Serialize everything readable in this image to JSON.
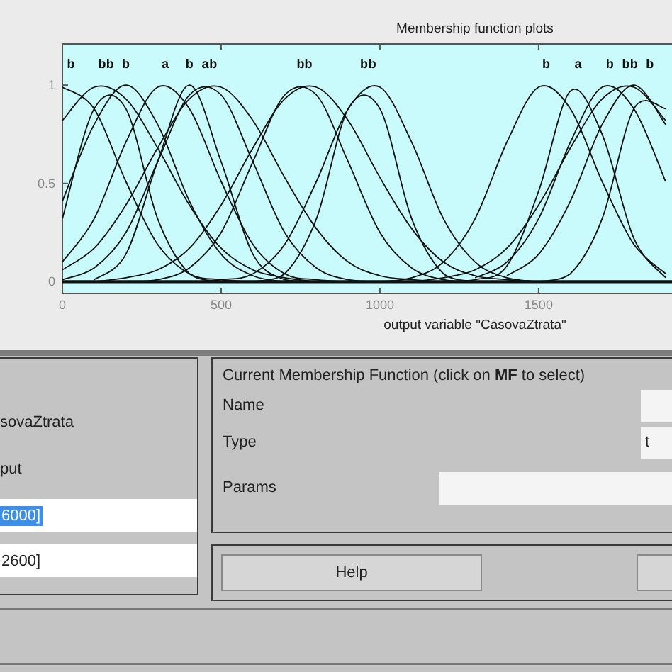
{
  "chart": {
    "chart_data": {
      "type": "line",
      "title": "Membership function plots",
      "xlabel": "output variable \"CasovaZtrata\"",
      "x": [
        0,
        100,
        200,
        300,
        400,
        500,
        600,
        700,
        800,
        900,
        1000,
        1100,
        1200,
        1300,
        1400,
        1500,
        1600,
        1700,
        1800,
        1900
      ],
      "xlim": [
        0,
        1920
      ],
      "ylim": [
        -0.06,
        1.21
      ],
      "xticks": [
        0,
        500,
        1000,
        1500
      ],
      "yticks": [
        0,
        0.5,
        1
      ],
      "series": [
        {
          "values": [
            0.99,
            0.88,
            0.51,
            0.19,
            0.04,
            0.01,
            0,
            null,
            null,
            null,
            null,
            null,
            null,
            null,
            null,
            null,
            null,
            null,
            null,
            null
          ]
        },
        {
          "values": [
            0.82,
            0.99,
            0.93,
            0.68,
            0.39,
            0.17,
            0.06,
            0.02,
            0,
            null,
            null,
            null,
            null,
            null,
            null,
            null,
            null,
            null,
            null,
            null
          ]
        },
        {
          "values": [
            0.32,
            0.88,
            0.88,
            0.32,
            0.04,
            0,
            null,
            null,
            null,
            null,
            null,
            null,
            null,
            null,
            null,
            null,
            null,
            null,
            null,
            null
          ]
        },
        {
          "values": [
            0.41,
            0.8,
            1,
            0.8,
            0.41,
            0.14,
            0.03,
            0,
            null,
            null,
            null,
            null,
            null,
            null,
            null,
            null,
            null,
            null,
            null,
            null
          ]
        },
        {
          "values": [
            0.1,
            0.32,
            0.71,
            0.99,
            0.88,
            0.51,
            0.19,
            0.04,
            0.01,
            0,
            null,
            null,
            null,
            null,
            null,
            null,
            null,
            null,
            null,
            null
          ]
        },
        {
          "values": [
            null,
            0.01,
            0.14,
            0.61,
            1,
            0.61,
            0.14,
            0.01,
            0,
            null,
            null,
            null,
            null,
            null,
            null,
            null,
            null,
            null,
            null,
            null
          ]
        },
        {
          "values": [
            0.01,
            0.07,
            0.25,
            0.61,
            0.95,
            0.95,
            0.61,
            0.25,
            0.07,
            0.01,
            0,
            null,
            null,
            null,
            null,
            null,
            null,
            null,
            null,
            null
          ]
        },
        {
          "values": [
            0.06,
            0.17,
            0.39,
            0.68,
            0.93,
            0.99,
            0.82,
            0.53,
            0.27,
            0.1,
            0.03,
            0.01,
            0,
            null,
            null,
            null,
            null,
            null,
            null,
            null
          ]
        },
        {
          "values": [
            null,
            null,
            0,
            0.01,
            0.07,
            0.25,
            0.61,
            0.95,
            0.95,
            0.61,
            0.25,
            0.07,
            0.01,
            0,
            null,
            null,
            null,
            null,
            null,
            null
          ]
        },
        {
          "values": [
            null,
            0,
            0.02,
            0.06,
            0.17,
            0.39,
            0.68,
            0.93,
            0.99,
            0.82,
            0.53,
            0.27,
            0.1,
            0.03,
            0.01,
            0,
            null,
            null,
            null,
            null
          ]
        },
        {
          "values": [
            null,
            null,
            null,
            null,
            null,
            null,
            0,
            0.04,
            0.32,
            0.88,
            0.88,
            0.32,
            0.04,
            0,
            null,
            null,
            null,
            null,
            null,
            null
          ]
        },
        {
          "values": [
            null,
            null,
            null,
            null,
            0,
            0.01,
            0.04,
            0.19,
            0.51,
            0.88,
            0.99,
            0.71,
            0.32,
            0.1,
            0.02,
            0,
            null,
            null,
            null,
            null
          ]
        },
        {
          "values": [
            null,
            null,
            null,
            null,
            null,
            null,
            null,
            null,
            null,
            null,
            0,
            0.02,
            0.1,
            0.32,
            0.71,
            0.99,
            0.88,
            0.51,
            0.19,
            0.04
          ]
        },
        {
          "values": [
            null,
            null,
            null,
            null,
            null,
            null,
            null,
            null,
            null,
            null,
            null,
            null,
            0,
            0.01,
            0.08,
            0.46,
            0.97,
            0.75,
            0.22,
            0.02
          ]
        },
        {
          "values": [
            null,
            null,
            null,
            null,
            null,
            null,
            null,
            null,
            null,
            null,
            null,
            null,
            null,
            0.02,
            0.1,
            0.32,
            0.71,
            0.99,
            0.88,
            0.51
          ]
        },
        {
          "values": [
            null,
            null,
            null,
            null,
            null,
            null,
            null,
            null,
            null,
            null,
            null,
            0,
            0.02,
            0.06,
            0.17,
            0.39,
            0.68,
            0.93,
            0.99,
            0.82
          ]
        },
        {
          "values": [
            null,
            null,
            null,
            null,
            null,
            null,
            null,
            null,
            null,
            null,
            null,
            null,
            null,
            null,
            0.03,
            0.14,
            0.41,
            0.8,
            1,
            0.8
          ]
        },
        {
          "values": [
            null,
            null,
            null,
            null,
            null,
            null,
            null,
            null,
            null,
            null,
            null,
            null,
            null,
            null,
            null,
            0,
            0.04,
            0.32,
            0.88,
            0.88
          ]
        }
      ],
      "annotations": [
        "b",
        "b",
        "b",
        "b",
        "a",
        "b",
        "a",
        "b",
        "b",
        "b",
        "b",
        "b",
        "b",
        "a",
        "b",
        "b",
        "b",
        "b"
      ]
    }
  },
  "variable_panel": {
    "name_value": "sovaZtrata",
    "type_value": "put",
    "fields": [
      {
        "value": "6000]",
        "highlighted": true
      },
      {
        "value": "2600]",
        "highlighted": false
      }
    ]
  },
  "mf_panel": {
    "title": "Current Membership Function (click on **MF** to select)",
    "rows": [
      {
        "label": "Name",
        "kind": "short"
      },
      {
        "label": "Type",
        "kind": "short",
        "value": "t"
      },
      {
        "label": "Params",
        "kind": "wide"
      }
    ]
  },
  "buttons": {
    "help": "Help"
  }
}
